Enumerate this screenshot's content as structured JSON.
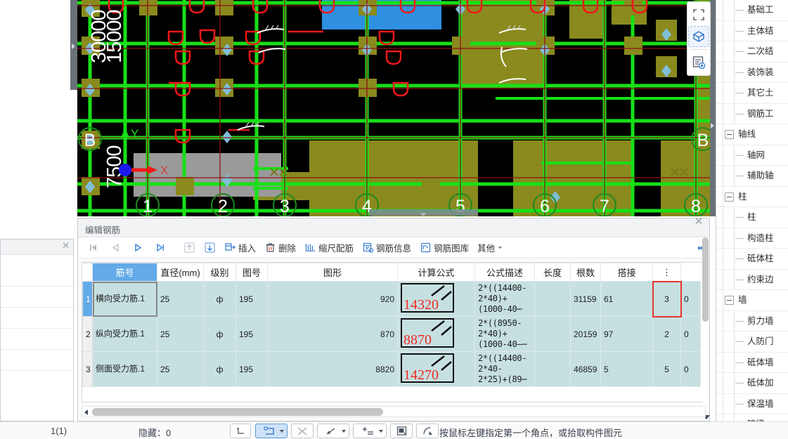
{
  "cad": {
    "dim_labels": [
      "30000",
      "15000",
      "7500"
    ],
    "axis_letters": [
      "B",
      "B"
    ],
    "axis_numbers": [
      "1",
      "2",
      "3",
      "4",
      "5",
      "6",
      "7",
      "8"
    ],
    "ucs_x_label": "X",
    "ucs_y_label": "Y",
    "tools": [
      {
        "name": "fit-frame-icon",
        "title": "全屏"
      },
      {
        "name": "three-d-box-icon",
        "title": "三维"
      },
      {
        "name": "list-eye-icon",
        "title": "显示设置"
      }
    ]
  },
  "tree": {
    "items": [
      {
        "label": "基础工",
        "level": 2,
        "expander": false
      },
      {
        "label": "主体结",
        "level": 2,
        "expander": false
      },
      {
        "label": "二次结",
        "level": 2,
        "expander": false
      },
      {
        "label": "装饰装",
        "level": 2,
        "expander": false
      },
      {
        "label": "其它土",
        "level": 2,
        "expander": false
      },
      {
        "label": "钢筋工",
        "level": 2,
        "expander": false
      },
      {
        "label": "轴线",
        "level": 1,
        "expander": true
      },
      {
        "label": "轴网",
        "level": 2,
        "expander": false
      },
      {
        "label": "辅助轴",
        "level": 2,
        "expander": false
      },
      {
        "label": "柱",
        "level": 1,
        "expander": true
      },
      {
        "label": "柱",
        "level": 2,
        "expander": false
      },
      {
        "label": "构造柱",
        "level": 2,
        "expander": false
      },
      {
        "label": "砥体柱",
        "level": 2,
        "expander": false
      },
      {
        "label": "约束边",
        "level": 2,
        "expander": false
      },
      {
        "label": "墙",
        "level": 1,
        "expander": true
      },
      {
        "label": "剪力墙",
        "level": 2,
        "expander": false
      },
      {
        "label": "人防门",
        "level": 2,
        "expander": false
      },
      {
        "label": "砥体墙",
        "level": 2,
        "expander": false
      },
      {
        "label": "砥体加",
        "level": 2,
        "expander": false
      },
      {
        "label": "保温墙",
        "level": 2,
        "expander": false
      },
      {
        "label": "暗梁",
        "level": 2,
        "expander": false
      }
    ]
  },
  "dialog": {
    "title": "编辑钢筋",
    "close_label": "✕",
    "toolbar": {
      "nav_first": "⏮",
      "nav_prev": "◁",
      "nav_next": "▷",
      "nav_last": "⏭",
      "move_up": "↑",
      "move_down": "↓",
      "insert_label": "插入",
      "delete_label": "删除",
      "scale_label": "缩尺配筋",
      "info_label": "钢筋信息",
      "library_label": "钢筋图库",
      "other_label": "其他",
      "overflow_label": "▸▸"
    },
    "table": {
      "headers": [
        "筋号",
        "直径(mm)",
        "级别",
        "图号",
        "图形",
        "计算公式",
        "公式描述",
        "长度",
        "根数",
        "搭接",
        "⋮"
      ],
      "selected_header_index": 0,
      "rows": [
        {
          "index": "1",
          "name": "横向受力筋.1",
          "diameter": "25",
          "level": "ф",
          "tuhao": "195",
          "shape_num": "920",
          "graphic_num": "14320",
          "formula": "2*((14400-2*40)+(1000-40⋯",
          "desc": "",
          "length": "31159",
          "count": "61",
          "lap": "3",
          "last": "0",
          "active": true,
          "lap_selected": true
        },
        {
          "index": "2",
          "name": "纵向受力筋.1",
          "diameter": "25",
          "level": "ф",
          "tuhao": "195",
          "shape_num": "870",
          "graphic_num": "8870",
          "formula": "2*((8950-2*40)+(1000-40—⋯",
          "desc": "",
          "length": "20159",
          "count": "97",
          "lap": "2",
          "last": "0",
          "active": false,
          "lap_selected": false
        },
        {
          "index": "3",
          "name": "侧面受力筋.1",
          "diameter": "25",
          "level": "ф",
          "tuhao": "195",
          "shape_num": "8820",
          "graphic_num": "14270",
          "formula": "2*((14400-2*40-2*25)+(89⋯",
          "desc": "",
          "length": "46859",
          "count": "5",
          "lap": "5",
          "last": "0",
          "active": false,
          "lap_selected": false
        }
      ]
    }
  },
  "status": {
    "count": "1(1)",
    "hidden": "隐藏：0",
    "message": "按鼠标左键指定第一个角点，或拾取构件图元",
    "buttons": [
      {
        "name": "snap-point-button",
        "active": false,
        "dropdown": false
      },
      {
        "name": "rectangle-select-button",
        "active": true,
        "dropdown": true
      },
      {
        "name": "clear-selection-button",
        "active": false,
        "dropdown": false
      },
      {
        "name": "line-tool-button",
        "active": false,
        "dropdown": true
      },
      {
        "name": "add-dimension-button",
        "active": false,
        "dropdown": true
      },
      {
        "name": "fill-region-button",
        "active": false,
        "dropdown": false
      },
      {
        "name": "polyline-pick-button",
        "active": false,
        "dropdown": false
      }
    ]
  },
  "colors": {
    "accent": "#63aae8",
    "cell_bg": "#c6e0e1",
    "red": "#ef2b23",
    "cad_bg": "#000000"
  }
}
